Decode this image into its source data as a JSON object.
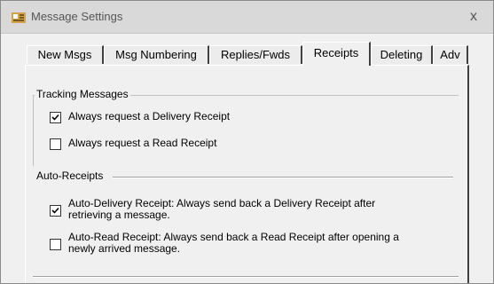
{
  "window": {
    "title": "Message Settings",
    "close_glyph": "x",
    "app_icon": "app-icon"
  },
  "tabs": [
    {
      "label": "New Msgs",
      "active": false
    },
    {
      "label": "Msg Numbering",
      "active": false
    },
    {
      "label": "Replies/Fwds",
      "active": false
    },
    {
      "label": "Receipts",
      "active": true
    },
    {
      "label": "Deleting",
      "active": false
    },
    {
      "label": "Adv",
      "active": false
    }
  ],
  "tracking": {
    "heading": "Tracking Messages",
    "delivery_receipt": {
      "label": "Always request a Delivery Receipt",
      "checked": true
    },
    "read_receipt": {
      "label": "Always request a Read Receipt",
      "checked": false
    }
  },
  "auto_receipts": {
    "heading": "Auto-Receipts",
    "auto_delivery": {
      "line1": "Auto-Delivery Receipt:  Always send back a Delivery Receipt after",
      "line2": "retrieving a message.",
      "checked": true
    },
    "auto_read": {
      "line1": "Auto-Read Receipt:  Always send back a Read Receipt after opening a",
      "line2": "newly arrived message.",
      "checked": false
    }
  }
}
